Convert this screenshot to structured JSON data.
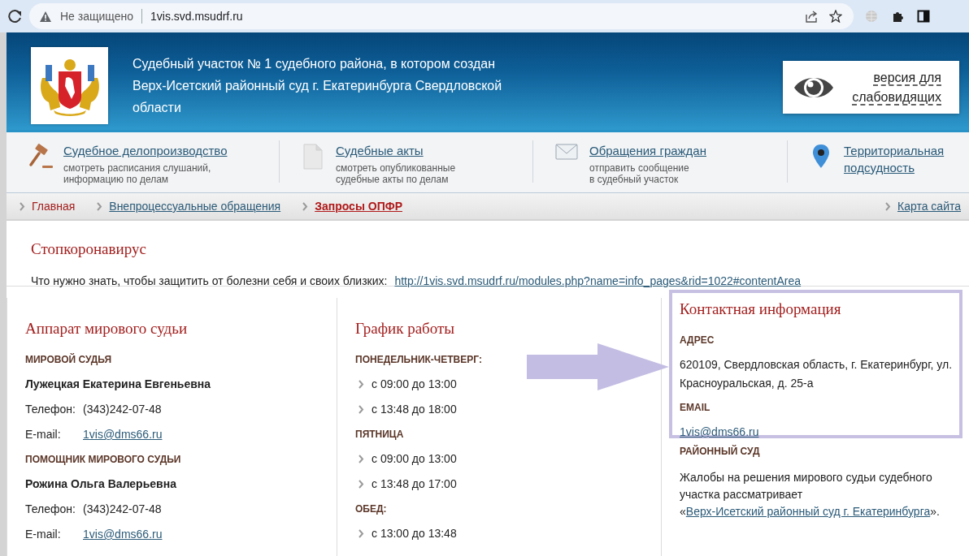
{
  "browser": {
    "security_label": "Не защищено",
    "url": "1vis.svd.msudrf.ru"
  },
  "header": {
    "title": "Судебный участок № 1 судебного района, в котором создан\nВерх-Исетский районный суд г. Екатеринбурга Свердловской\nобласти",
    "accessibility_button": "версия для\nслабовидящих"
  },
  "services": [
    {
      "title": "Судебное делопроизводство",
      "subtitle": "смотреть расписания слушаний,\nинформацию по делам",
      "kind": "gavel"
    },
    {
      "title": "Судебные акты",
      "subtitle": "смотреть опубликованные\nсудебные акты по делам",
      "kind": "document"
    },
    {
      "title": "Обращения граждан",
      "subtitle": "отправить сообщение\nв судебный участок",
      "kind": "mail"
    },
    {
      "title": "Территориальная\nподсудность",
      "kind": "pin"
    }
  ],
  "breadcrumbs": [
    {
      "label": "Главная",
      "kind": "home"
    },
    {
      "label": "Внепроцессуальные обращения",
      "kind": "link"
    },
    {
      "label": "Запросы ОПФР",
      "kind": "current"
    }
  ],
  "site_map": "Карта сайта",
  "covid": {
    "title": "Стопкоронавирус",
    "text": "Что нужно знать, чтобы защитить от болезни себя и своих близких:",
    "link": "http://1vis.svd.msudrf.ru/modules.php?name=info_pages&rid=1022#contentArea"
  },
  "apparatus": {
    "title": "Аппарат мирового судьи",
    "staff": [
      {
        "role": "МИРОВОЙ СУДЬЯ",
        "name": "Лужецкая Екатерина Евгеньевна",
        "phone_label": "Телефон:",
        "phone": "(343)242-07-48",
        "email_label": "E-mail:",
        "email": "1vis@dms66.ru"
      },
      {
        "role": "ПОМОЩНИК МИРОВОГО СУДЬИ",
        "name": "Рожина Ольга Валерьевна",
        "phone_label": "Телефон:",
        "phone": "(343)242-07-48",
        "email_label": "E-mail:",
        "email": "1vis@dms66.ru"
      }
    ]
  },
  "schedule": {
    "title": "График работы",
    "groups": [
      {
        "label": "ПОНЕДЕЛЬНИК-ЧЕТВЕРГ:",
        "times": [
          "с 09:00 до 13:00",
          "с 13:48 до 18:00"
        ]
      },
      {
        "label": "ПЯТНИЦА",
        "times": [
          "с 09:00 до 13:00",
          "с 13:48 до 17:00"
        ]
      },
      {
        "label": "ОБЕД:",
        "times": [
          "с 13:00 до 13:48"
        ]
      }
    ]
  },
  "contacts": {
    "title": "Контактная информация",
    "highlighted": true,
    "address_label": "АДРЕС",
    "address": "620109, Свердловская область, г. Екатеринбург, ул.\nКрасноуральская, д. 25-а",
    "email_label": "EMAIL",
    "email": "1vis@dms66.ru",
    "court_label": "РАЙОННЫЙ СУД",
    "complaint_text": "Жалобы на решения мирового судьи судебного\nучастка рассматривает\n«",
    "court_link": "Верх-Исетский районный суд г. Екатеринбурга",
    "complaint_end": "»."
  }
}
